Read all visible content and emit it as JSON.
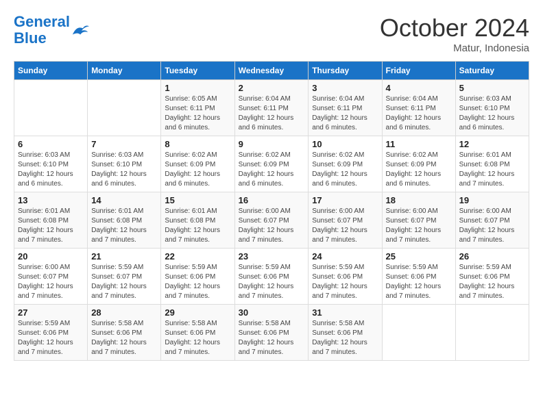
{
  "logo": {
    "line1": "General",
    "line2": "Blue"
  },
  "title": "October 2024",
  "subtitle": "Matur, Indonesia",
  "days_header": [
    "Sunday",
    "Monday",
    "Tuesday",
    "Wednesday",
    "Thursday",
    "Friday",
    "Saturday"
  ],
  "weeks": [
    [
      {
        "num": "",
        "info": ""
      },
      {
        "num": "",
        "info": ""
      },
      {
        "num": "1",
        "info": "Sunrise: 6:05 AM\nSunset: 6:11 PM\nDaylight: 12 hours and 6 minutes."
      },
      {
        "num": "2",
        "info": "Sunrise: 6:04 AM\nSunset: 6:11 PM\nDaylight: 12 hours and 6 minutes."
      },
      {
        "num": "3",
        "info": "Sunrise: 6:04 AM\nSunset: 6:11 PM\nDaylight: 12 hours and 6 minutes."
      },
      {
        "num": "4",
        "info": "Sunrise: 6:04 AM\nSunset: 6:11 PM\nDaylight: 12 hours and 6 minutes."
      },
      {
        "num": "5",
        "info": "Sunrise: 6:03 AM\nSunset: 6:10 PM\nDaylight: 12 hours and 6 minutes."
      }
    ],
    [
      {
        "num": "6",
        "info": "Sunrise: 6:03 AM\nSunset: 6:10 PM\nDaylight: 12 hours and 6 minutes."
      },
      {
        "num": "7",
        "info": "Sunrise: 6:03 AM\nSunset: 6:10 PM\nDaylight: 12 hours and 6 minutes."
      },
      {
        "num": "8",
        "info": "Sunrise: 6:02 AM\nSunset: 6:09 PM\nDaylight: 12 hours and 6 minutes."
      },
      {
        "num": "9",
        "info": "Sunrise: 6:02 AM\nSunset: 6:09 PM\nDaylight: 12 hours and 6 minutes."
      },
      {
        "num": "10",
        "info": "Sunrise: 6:02 AM\nSunset: 6:09 PM\nDaylight: 12 hours and 6 minutes."
      },
      {
        "num": "11",
        "info": "Sunrise: 6:02 AM\nSunset: 6:09 PM\nDaylight: 12 hours and 6 minutes."
      },
      {
        "num": "12",
        "info": "Sunrise: 6:01 AM\nSunset: 6:08 PM\nDaylight: 12 hours and 7 minutes."
      }
    ],
    [
      {
        "num": "13",
        "info": "Sunrise: 6:01 AM\nSunset: 6:08 PM\nDaylight: 12 hours and 7 minutes."
      },
      {
        "num": "14",
        "info": "Sunrise: 6:01 AM\nSunset: 6:08 PM\nDaylight: 12 hours and 7 minutes."
      },
      {
        "num": "15",
        "info": "Sunrise: 6:01 AM\nSunset: 6:08 PM\nDaylight: 12 hours and 7 minutes."
      },
      {
        "num": "16",
        "info": "Sunrise: 6:00 AM\nSunset: 6:07 PM\nDaylight: 12 hours and 7 minutes."
      },
      {
        "num": "17",
        "info": "Sunrise: 6:00 AM\nSunset: 6:07 PM\nDaylight: 12 hours and 7 minutes."
      },
      {
        "num": "18",
        "info": "Sunrise: 6:00 AM\nSunset: 6:07 PM\nDaylight: 12 hours and 7 minutes."
      },
      {
        "num": "19",
        "info": "Sunrise: 6:00 AM\nSunset: 6:07 PM\nDaylight: 12 hours and 7 minutes."
      }
    ],
    [
      {
        "num": "20",
        "info": "Sunrise: 6:00 AM\nSunset: 6:07 PM\nDaylight: 12 hours and 7 minutes."
      },
      {
        "num": "21",
        "info": "Sunrise: 5:59 AM\nSunset: 6:07 PM\nDaylight: 12 hours and 7 minutes."
      },
      {
        "num": "22",
        "info": "Sunrise: 5:59 AM\nSunset: 6:06 PM\nDaylight: 12 hours and 7 minutes."
      },
      {
        "num": "23",
        "info": "Sunrise: 5:59 AM\nSunset: 6:06 PM\nDaylight: 12 hours and 7 minutes."
      },
      {
        "num": "24",
        "info": "Sunrise: 5:59 AM\nSunset: 6:06 PM\nDaylight: 12 hours and 7 minutes."
      },
      {
        "num": "25",
        "info": "Sunrise: 5:59 AM\nSunset: 6:06 PM\nDaylight: 12 hours and 7 minutes."
      },
      {
        "num": "26",
        "info": "Sunrise: 5:59 AM\nSunset: 6:06 PM\nDaylight: 12 hours and 7 minutes."
      }
    ],
    [
      {
        "num": "27",
        "info": "Sunrise: 5:59 AM\nSunset: 6:06 PM\nDaylight: 12 hours and 7 minutes."
      },
      {
        "num": "28",
        "info": "Sunrise: 5:58 AM\nSunset: 6:06 PM\nDaylight: 12 hours and 7 minutes."
      },
      {
        "num": "29",
        "info": "Sunrise: 5:58 AM\nSunset: 6:06 PM\nDaylight: 12 hours and 7 minutes."
      },
      {
        "num": "30",
        "info": "Sunrise: 5:58 AM\nSunset: 6:06 PM\nDaylight: 12 hours and 7 minutes."
      },
      {
        "num": "31",
        "info": "Sunrise: 5:58 AM\nSunset: 6:06 PM\nDaylight: 12 hours and 7 minutes."
      },
      {
        "num": "",
        "info": ""
      },
      {
        "num": "",
        "info": ""
      }
    ]
  ]
}
